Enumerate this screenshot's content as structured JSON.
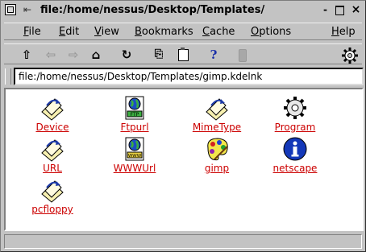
{
  "window": {
    "title": "file:/home/nessus/Desktop/Templates/",
    "minimize": "-",
    "maximize": "□",
    "close": "×"
  },
  "menu": [
    {
      "label": "File",
      "accel": "F",
      "rest": "ile"
    },
    {
      "label": "Edit",
      "accel": "E",
      "rest": "dit"
    },
    {
      "label": "View",
      "accel": "V",
      "rest": "iew"
    },
    {
      "label": "Bookmarks",
      "accel": "B",
      "rest": "ookmarks"
    },
    {
      "label": "Cache",
      "accel": "C",
      "rest": "ache"
    },
    {
      "label": "Options",
      "accel": "O",
      "rest": "ptions"
    },
    {
      "label": "Help",
      "accel": "H",
      "rest": "elp"
    }
  ],
  "toolbar": {
    "up": "⇧",
    "back": "⇦",
    "forward": "⇨",
    "home": "⌂",
    "reload": "↻",
    "copy": "⎘",
    "paste": "📋",
    "help": "?",
    "stop": "▮"
  },
  "location": {
    "url": "file:/home/nessus/Desktop/Templates/gimp.kdelnk"
  },
  "files": [
    {
      "label": "Device",
      "icon": "kdelnk-doc-icon"
    },
    {
      "label": "Ftpurl",
      "icon": "ftp-globe-icon"
    },
    {
      "label": "MimeType",
      "icon": "kdelnk-doc-icon"
    },
    {
      "label": "Program",
      "icon": "gear-icon"
    },
    {
      "label": "URL",
      "icon": "kdelnk-doc-icon"
    },
    {
      "label": "WWWUrl",
      "icon": "www-globe-icon"
    },
    {
      "label": "gimp",
      "icon": "gimp-palette-icon"
    },
    {
      "label": "netscape",
      "icon": "info-icon"
    },
    {
      "label": "pcfloppy",
      "icon": "kdelnk-doc-icon"
    }
  ],
  "status": {
    "text": ""
  },
  "colors": {
    "link": "#cc0000",
    "chrome": "#c3c3c3"
  }
}
